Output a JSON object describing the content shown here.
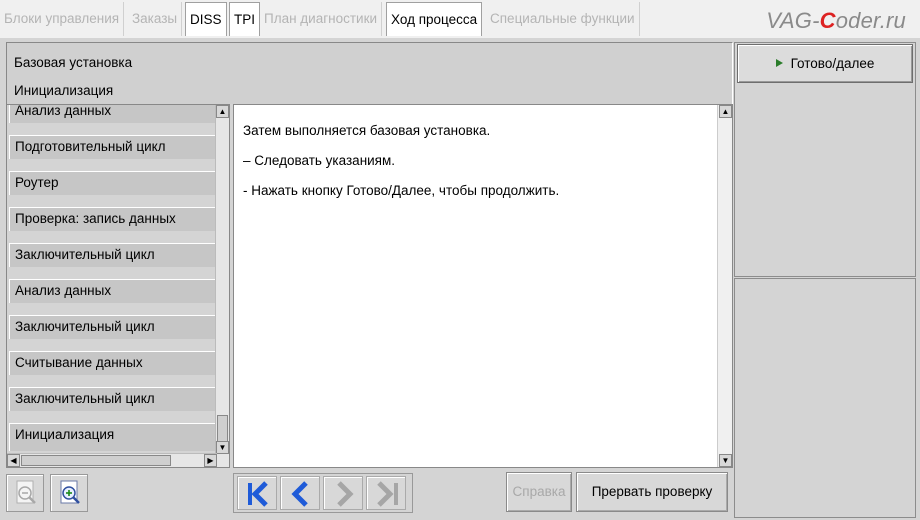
{
  "tabs": [
    {
      "label": "Блоки управления",
      "active": false
    },
    {
      "label": "Заказы",
      "active": false
    },
    {
      "label": "DISS",
      "active": true
    },
    {
      "label": "TPI",
      "active": true
    },
    {
      "label": "План диагностики",
      "active": false
    },
    {
      "label": "Ход процесса",
      "active": true
    },
    {
      "label": "Специальные функции",
      "active": false
    }
  ],
  "logo": {
    "prefix": "VAG-",
    "highlight": "C",
    "suffix": "oder.ru"
  },
  "header": {
    "line1": "Базовая установка",
    "line2": "Инициализация"
  },
  "steps": [
    "Анализ данных",
    "Подготовительный цикл",
    "Роутер",
    "Проверка: запись данных",
    "Заключительный цикл",
    "Анализ данных",
    "Заключительный цикл",
    "Считывание данных",
    "Заключительный цикл",
    "Инициализация"
  ],
  "content": {
    "lines": [
      "Затем выполняется базовая установка.",
      "– Следовать указаниям.",
      "- Нажать кнопку Готово/Далее, чтобы продолжить."
    ]
  },
  "right": {
    "ready_label": "Готово/далее"
  },
  "bottom": {
    "help_label": "Справка",
    "abort_label": "Прервать проверку"
  },
  "colors": {
    "accent_blue": "#1f5bd8",
    "play_green": "#2b7d2b",
    "logo_red": "#d22222"
  },
  "icons": {
    "zoom_out": "zoom-out-icon",
    "zoom_in": "zoom-in-icon",
    "first": "skip-first-icon",
    "prev": "chevron-left-icon",
    "next": "chevron-right-icon",
    "last": "skip-last-icon"
  }
}
